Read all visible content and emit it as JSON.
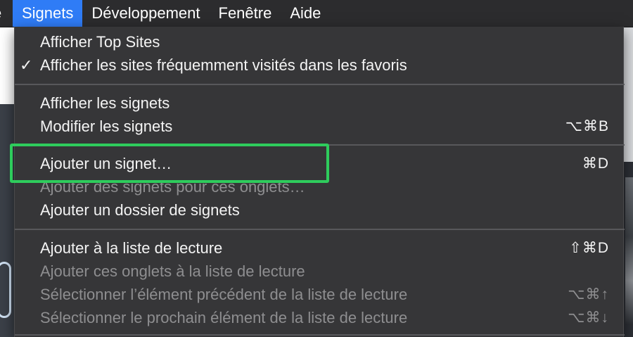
{
  "menubar": {
    "items": [
      {
        "label": "e",
        "active": false
      },
      {
        "label": "Signets",
        "active": true
      },
      {
        "label": "Développement",
        "active": false
      },
      {
        "label": "Fenêtre",
        "active": false
      },
      {
        "label": "Aide",
        "active": false
      }
    ]
  },
  "menu": {
    "rows": [
      {
        "label": "Afficher Top Sites",
        "checked": false,
        "shortcut": "",
        "enabled": true
      },
      {
        "label": "Afficher les sites fréquemment visités dans les favoris",
        "checked": true,
        "check_glyph": "✓",
        "shortcut": "",
        "enabled": true
      },
      {
        "label": "Afficher les signets",
        "checked": false,
        "shortcut": "",
        "enabled": true
      },
      {
        "label": "Modifier les signets",
        "checked": false,
        "shortcut": "⌥⌘B",
        "enabled": true
      },
      {
        "label": "Ajouter un signet…",
        "checked": false,
        "shortcut": "⌘D",
        "enabled": true
      },
      {
        "label": "Ajouter des signets pour ces onglets…",
        "checked": false,
        "shortcut": "",
        "enabled": false
      },
      {
        "label": "Ajouter un dossier de signets",
        "checked": false,
        "shortcut": "",
        "enabled": true
      },
      {
        "label": "Ajouter à la liste de lecture",
        "checked": false,
        "shortcut": "⇧⌘D",
        "enabled": true
      },
      {
        "label": "Ajouter ces onglets à la liste de lecture",
        "checked": false,
        "shortcut": "",
        "enabled": false
      },
      {
        "label": "Sélectionner l’élément précédent de la liste de lecture",
        "checked": false,
        "shortcut": "⌥⌘↑",
        "enabled": false
      },
      {
        "label": "Sélectionner le prochain élément de la liste de lecture",
        "checked": false,
        "shortcut": "⌥⌘↓",
        "enabled": false
      }
    ]
  },
  "colors": {
    "menubar_bg": "#2c2c2e",
    "active_menu": "#2f7cf6",
    "menu_bg": "#363638",
    "text": "#f4f4f4",
    "disabled_text": "#8e8e90",
    "highlight_border": "#2ecc5c"
  }
}
